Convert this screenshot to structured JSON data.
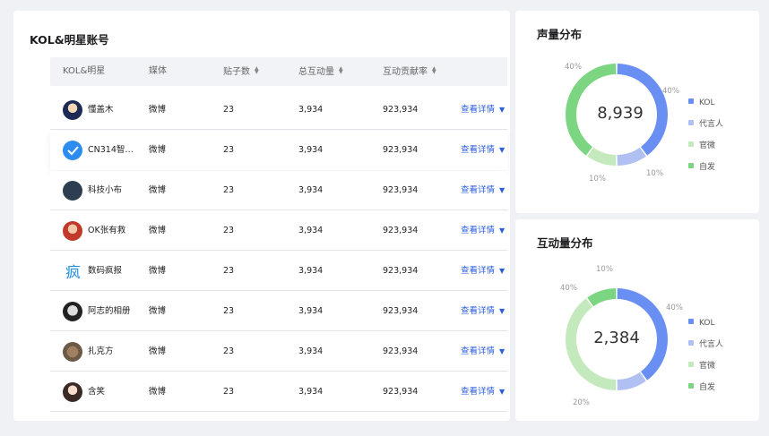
{
  "kol_table": {
    "title": "KOL&明星账号",
    "columns": [
      {
        "label": "KOL&明星",
        "sortable": false
      },
      {
        "label": "媒体",
        "sortable": false
      },
      {
        "label": "贴子数",
        "sortable": true
      },
      {
        "label": "总互动量",
        "sortable": true
      },
      {
        "label": "互动贡献率",
        "sortable": true
      }
    ],
    "sort_icon": "sort-updown-icon",
    "detail_label": "查看详情",
    "rows": [
      {
        "name": "懂盖木",
        "media": "微博",
        "posts": "23",
        "interactions": "3,934",
        "contribution": "923,934",
        "avatar": "avatar-cartoon-icon"
      },
      {
        "name": "CN314智能...",
        "media": "微博",
        "posts": "23",
        "interactions": "3,934",
        "contribution": "923,934",
        "avatar": "avatar-logo-cn314-icon"
      },
      {
        "name": "科技小布",
        "media": "微博",
        "posts": "23",
        "interactions": "3,934",
        "contribution": "923,934",
        "avatar": "avatar-logo-dark-icon"
      },
      {
        "name": "OK张有救",
        "media": "微博",
        "posts": "23",
        "interactions": "3,934",
        "contribution": "923,934",
        "avatar": "avatar-person-icon"
      },
      {
        "name": "数码疯报",
        "media": "微博",
        "posts": "23",
        "interactions": "3,934",
        "contribution": "923,934",
        "avatar": "avatar-logo-feng-icon"
      },
      {
        "name": "阿志的相册",
        "media": "微博",
        "posts": "23",
        "interactions": "3,934",
        "contribution": "923,934",
        "avatar": "avatar-bw-icon"
      },
      {
        "name": "扎克方",
        "media": "微博",
        "posts": "23",
        "interactions": "3,934",
        "contribution": "923,934",
        "avatar": "avatar-cat-icon"
      },
      {
        "name": "含笑",
        "media": "微博",
        "posts": "23",
        "interactions": "3,934",
        "contribution": "923,934",
        "avatar": "avatar-woman-icon"
      }
    ]
  },
  "chart_data": [
    {
      "type": "pie",
      "donut": true,
      "title": "声量分布",
      "center_value": "8,939",
      "labels": [
        "KOL",
        "代言人",
        "官微",
        "自发"
      ],
      "values": [
        40,
        10,
        10,
        40
      ],
      "value_labels": [
        "40%",
        "10%",
        "10%",
        "40%"
      ],
      "colors": [
        "#6a8ff3",
        "#b1c0f2",
        "#c4e9bc",
        "#7cd681"
      ],
      "legend_position": "right"
    },
    {
      "type": "pie",
      "donut": true,
      "title": "互动量分布",
      "center_value": "2,384",
      "labels": [
        "KOL",
        "代言人",
        "官微",
        "自发"
      ],
      "values": [
        40,
        10,
        40,
        10
      ],
      "value_labels": [
        "40%",
        "20%",
        "40%",
        "10%"
      ],
      "colors": [
        "#6a8ff3",
        "#b1c0f2",
        "#c4e9bc",
        "#7cd681"
      ],
      "legend_position": "right"
    }
  ]
}
